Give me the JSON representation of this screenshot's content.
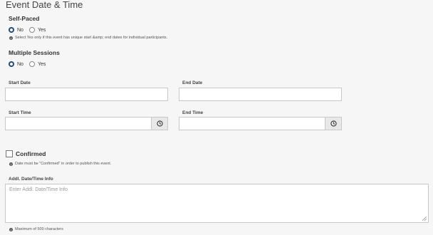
{
  "section": {
    "title": "Event Date & Time"
  },
  "self_paced": {
    "label": "Self-Paced",
    "options": [
      "No",
      "Yes"
    ],
    "selected": "No",
    "hint": "Select Yes only if this event has unique start &amp; end dates for individual participants."
  },
  "multiple_sessions": {
    "label": "Multiple Sessions",
    "options": [
      "No",
      "Yes"
    ],
    "selected": "No"
  },
  "start_date": {
    "label": "Start Date",
    "value": ""
  },
  "end_date": {
    "label": "End Date",
    "value": ""
  },
  "start_time": {
    "label": "Start Time",
    "value": "",
    "icon": "clock-icon"
  },
  "end_time": {
    "label": "End Time",
    "value": "",
    "icon": "clock-icon"
  },
  "confirmed": {
    "label": "Confirmed",
    "checked": false,
    "hint": "Date must be \"Confirmed\" in order to publish this event."
  },
  "addl_info": {
    "label": "Addl. Date/Time Info",
    "placeholder": "Enter Addl. Date/Time Info",
    "value": "",
    "hint": "Maximum of 500 characters"
  },
  "colors": {
    "radio_selected": "#1f4e79",
    "background": "#f6f6f6",
    "input_border": "#c8c8c8"
  }
}
